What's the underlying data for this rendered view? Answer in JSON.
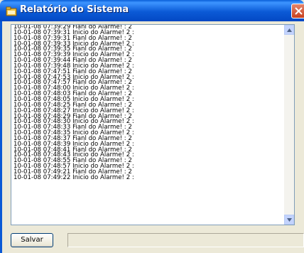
{
  "window": {
    "title": "Relatório do Sistema"
  },
  "log": {
    "lines": [
      "10-01-08 07:39:29 Fianl do Alarme! : 2",
      "10-01-08 07:39:31 Inicio do Alarme! 2 :",
      "10-01-08 07:39:31 Fianl do Alarme! : 2",
      "10-01-08 07:39:33 Inicio do Alarme! 2 :",
      "10-01-08 07:39:35 Fianl do Alarme! : 2",
      "10-01-08 07:39:39 Inicio do Alarme! 2 :",
      "10-01-08 07:39:44 Fianl do Alarme! : 2",
      "10-01-08 07:39:48 Inicio do Alarme! 2 :",
      "10-01-08 07:47:51 Fianl do Alarme! : 2",
      "10-01-08 07:47:53 Inicio do Alarme! 2 :",
      "10-01-08 07:47:57 Fianl do Alarme! : 2",
      "10-01-08 07:48:00 Inicio do Alarme! 2 :",
      "10-01-08 07:48:03 Fianl do Alarme! : 2",
      "10-01-08 07:48:05 Inicio do Alarme! 2 :",
      "10-01-08 07:48:25 Fianl do Alarme! : 2",
      "10-01-08 07:48:27 Inicio do Alarme! 2 :",
      "10-01-08 07:48:29 Fianl do Alarme! : 2",
      "10-01-08 07:48:30 Inicio do Alarme! 2 :",
      "10-01-08 07:48:33 Fianl do Alarme! : 2",
      "10-01-08 07:48:35 Inicio do Alarme! 2 :",
      "10-01-08 07:48:37 Fianl do Alarme! : 2",
      "10-01-08 07:48:39 Inicio do Alarme! 2 :",
      "10-01-08 07:48:41 Fianl do Alarme! : 2",
      "10-01-08 07:48:43 Inicio do Alarme! 2 :",
      "10-01-08 07:48:55 Fianl do Alarme! : 2",
      "10-01-08 07:48:57 Inicio do Alarme! 2 :",
      "10-01-08 07:49:21 Fianl do Alarme! : 2",
      "10-01-08 07:49:22 Inicio do Alarme! 2 :"
    ]
  },
  "footer": {
    "save_label": "Salvar",
    "status_text": ""
  },
  "icons": {
    "app": "application-icon",
    "close": "close-icon",
    "up": "arrow-up-icon",
    "down": "arrow-down-icon"
  },
  "colors": {
    "titlebar": "#0b5ad6",
    "close_button": "#d9512c",
    "window_face": "#ece9d8"
  }
}
